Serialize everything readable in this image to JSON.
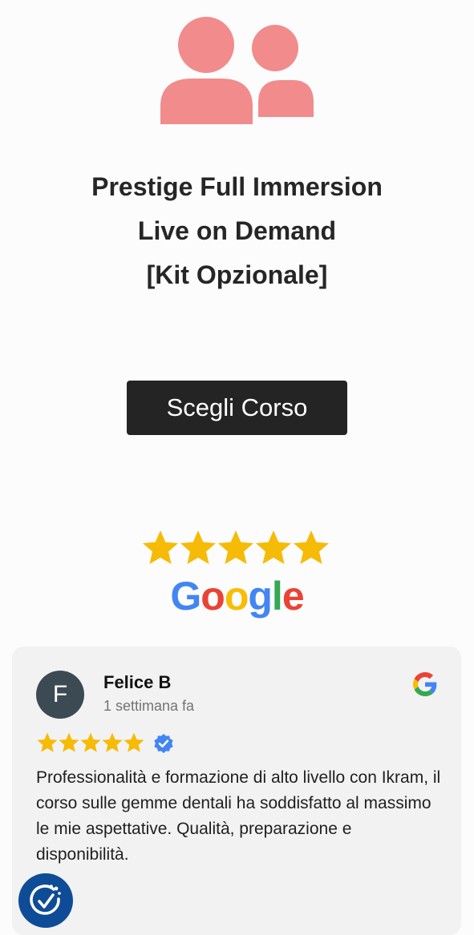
{
  "product": {
    "title_lines": [
      "Prestige Full Immersion",
      "Live on Demand",
      "[Kit Opzionale]"
    ]
  },
  "cta": {
    "label": "Scegli Corso"
  },
  "rating_badge": {
    "stars": 5,
    "brand_letters": [
      "G",
      "o",
      "o",
      "g",
      "l",
      "e"
    ],
    "brand_colors": [
      "#4285F4",
      "#EA4335",
      "#FBBC05",
      "#4285F4",
      "#34A853",
      "#EA4335"
    ]
  },
  "review": {
    "avatar_initial": "F",
    "name": "Felice B",
    "time": "1 settimana fa",
    "stars": 5,
    "text": "Professionalità e formazione di alto livello con Ikram, il corso sulle gemme dentali ha soddisfatto al massimo le mie aspettative. Qualità, preparazione e disponibilità."
  },
  "colors": {
    "icon_pink": "#F28B8B",
    "star_gold": "#F6BB06",
    "button_dark": "#242424",
    "verified_blue": "#4285F4",
    "a11y_blue": "#0f4c97"
  },
  "icons": {
    "people": "people-icon",
    "google": "google-g-icon",
    "verified": "verified-badge-icon",
    "accessibility": "accessibility-icon"
  }
}
